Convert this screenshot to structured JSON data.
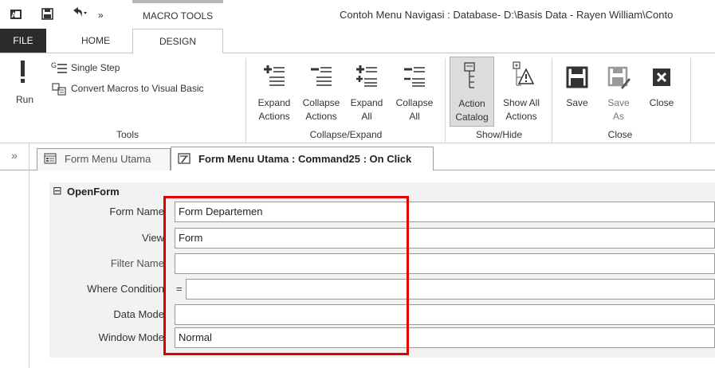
{
  "titlebar": {
    "qat_icons": [
      "access-logo-icon",
      "save-icon",
      "undo-icon",
      "customize-qat-icon"
    ],
    "contextual_tab": "MACRO TOOLS",
    "window_title": "Contoh Menu Navigasi : Database- D:\\Basis Data - Rayen William\\Conto"
  },
  "ribbon_tabs": {
    "file": "FILE",
    "home": "HOME",
    "design": "DESIGN"
  },
  "ribbon": {
    "tools": {
      "run": "Run",
      "single_step": "Single Step",
      "convert": "Convert Macros to Visual Basic",
      "group": "Tools"
    },
    "collapse_expand": {
      "expand_actions_1": "Expand",
      "expand_actions_2": "Actions",
      "collapse_actions_1": "Collapse",
      "collapse_actions_2": "Actions",
      "expand_all_1": "Expand",
      "expand_all_2": "All",
      "collapse_all_1": "Collapse",
      "collapse_all_2": "All",
      "group": "Collapse/Expand"
    },
    "show_hide": {
      "action_catalog_1": "Action",
      "action_catalog_2": "Catalog",
      "show_all_1": "Show All",
      "show_all_2": "Actions",
      "group": "Show/Hide"
    },
    "close": {
      "save": "Save",
      "save_as_1": "Save",
      "save_as_2": "As",
      "close": "Close",
      "group": "Close"
    }
  },
  "document_tabs": {
    "nav_toggle": "»",
    "form_tab": "Form Menu Utama",
    "macro_tab": "Form Menu Utama : Command25 : On Click"
  },
  "macro": {
    "action": "OpenForm",
    "collapse_symbol": "⊟",
    "arguments": [
      {
        "label": "Form Name",
        "value": ""
      },
      {
        "label": "View",
        "value": "Form"
      },
      {
        "label": "Filter Name",
        "value": ""
      },
      {
        "label": "Where Condition",
        "value": ""
      },
      {
        "label": "Data Mode",
        "value": ""
      },
      {
        "label": "Window Mode",
        "value": "Normal"
      }
    ],
    "form_name_value": "Form Departemen",
    "where_prefix": "="
  },
  "colors": {
    "highlight": "#e00000",
    "file_tab_bg": "#2b2b2b",
    "active_button_bg": "#dcdcdc"
  }
}
